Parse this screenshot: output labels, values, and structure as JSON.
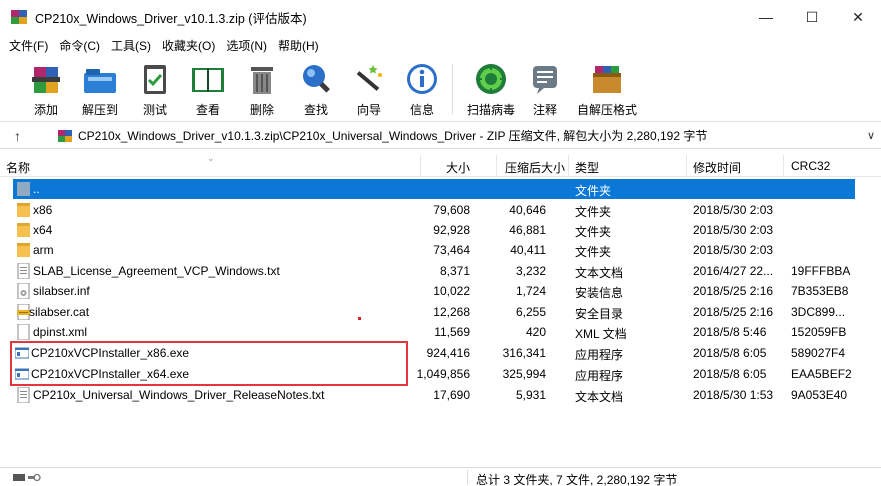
{
  "window": {
    "title": "CP210x_Windows_Driver_v10.1.3.zip (评估版本)",
    "minimize": "—",
    "maximize": "☐",
    "close": "✕"
  },
  "menu": [
    "文件(F)",
    "命令(C)",
    "工具(S)",
    "收藏夹(O)",
    "选项(N)",
    "帮助(H)"
  ],
  "toolbar": {
    "add": "添加",
    "extract_to": "解压到",
    "test": "测试",
    "view": "查看",
    "delete": "删除",
    "find": "查找",
    "wizard": "向导",
    "info": "信息",
    "scan_virus": "扫描病毒",
    "comment": "注释",
    "sfx": "自解压格式"
  },
  "path": {
    "up": "↑",
    "text": "CP210x_Windows_Driver_v10.1.3.zip\\CP210x_Universal_Windows_Driver - ZIP 压缩文件, 解包大小为 2,280,192 字节",
    "chevron": "∨"
  },
  "columns": {
    "name": "名称",
    "size": "大小",
    "packed": "压缩后大小",
    "type": "类型",
    "mtime": "修改时间",
    "crc": "CRC32"
  },
  "files": [
    {
      "name": "..",
      "size": "",
      "packed": "",
      "type": "文件夹",
      "mtime": "",
      "crc": "",
      "icon": "folder-up-icon",
      "selected": true
    },
    {
      "name": "x86",
      "size": "79,608",
      "packed": "40,646",
      "type": "文件夹",
      "mtime": "2018/5/30 2:03",
      "crc": "",
      "icon": "folder-icon"
    },
    {
      "name": "x64",
      "size": "92,928",
      "packed": "46,881",
      "type": "文件夹",
      "mtime": "2018/5/30 2:03",
      "crc": "",
      "icon": "folder-icon"
    },
    {
      "name": "arm",
      "size": "73,464",
      "packed": "40,411",
      "type": "文件夹",
      "mtime": "2018/5/30 2:03",
      "crc": "",
      "icon": "folder-icon"
    },
    {
      "name": "SLAB_License_Agreement_VCP_Windows.txt",
      "size": "8,371",
      "packed": "3,232",
      "type": "文本文档",
      "mtime": "2016/4/27 22...",
      "crc": "19FFFBBA",
      "icon": "text-file-icon"
    },
    {
      "name": "silabser.inf",
      "size": "10,022",
      "packed": "1,724",
      "type": "安装信息",
      "mtime": "2018/5/25 2:16",
      "crc": "7B353EB8",
      "icon": "inf-file-icon"
    },
    {
      "name": "silabser.cat",
      "size": "12,268",
      "packed": "6,255",
      "type": "安全目录",
      "mtime": "2018/5/25 2:16",
      "crc": "3DC899...",
      "icon": "cat-file-icon"
    },
    {
      "name": "dpinst.xml",
      "size": "11,569",
      "packed": "420",
      "type": "XML 文档",
      "mtime": "2018/5/8 5:46",
      "crc": "152059FB",
      "icon": "xml-file-icon"
    },
    {
      "name": "CP210xVCPInstaller_x86.exe",
      "size": "924,416",
      "packed": "316,341",
      "type": "应用程序",
      "mtime": "2018/5/8 6:05",
      "crc": "589027F4",
      "icon": "exe-file-icon"
    },
    {
      "name": "CP210xVCPInstaller_x64.exe",
      "size": "1,049,856",
      "packed": "325,994",
      "type": "应用程序",
      "mtime": "2018/5/8 6:05",
      "crc": "EAA5BEF2",
      "icon": "exe-file-icon"
    },
    {
      "name": "CP210x_Universal_Windows_Driver_ReleaseNotes.txt",
      "size": "17,690",
      "packed": "5,931",
      "type": "文本文档",
      "mtime": "2018/5/30 1:53",
      "crc": "9A053E40",
      "icon": "text-file-icon"
    }
  ],
  "status": {
    "summary": "总计 3 文件夹, 7 文件, 2,280,192 字节"
  },
  "colors": {
    "selection": "#0b78d7",
    "highlight_box": "#e0363c",
    "folder": "#f5c04d"
  }
}
